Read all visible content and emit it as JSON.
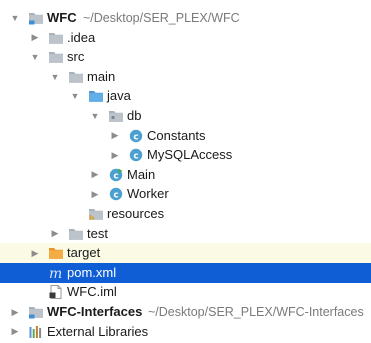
{
  "tree": [
    {
      "id": "wfc",
      "label": "WFC",
      "bold": true,
      "path": "~/Desktop/SER_PLEX/WFC",
      "icon": "module-folder-icon",
      "arrow": "expanded",
      "depth": 0
    },
    {
      "id": "idea",
      "label": ".idea",
      "icon": "folder-icon",
      "arrow": "collapsed",
      "depth": 1
    },
    {
      "id": "src",
      "label": "src",
      "icon": "folder-icon",
      "arrow": "expanded",
      "depth": 1
    },
    {
      "id": "main",
      "label": "main",
      "icon": "folder-icon",
      "arrow": "expanded",
      "depth": 2
    },
    {
      "id": "java",
      "label": "java",
      "icon": "source-folder-icon",
      "arrow": "expanded",
      "depth": 3
    },
    {
      "id": "db",
      "label": "db",
      "icon": "package-icon",
      "arrow": "expanded",
      "depth": 4
    },
    {
      "id": "constants",
      "label": "Constants",
      "icon": "class-icon",
      "arrow": "collapsed",
      "depth": 5
    },
    {
      "id": "mysqlaccess",
      "label": "MySQLAccess",
      "icon": "class-icon",
      "arrow": "collapsed",
      "depth": 5
    },
    {
      "id": "main-class",
      "label": "Main",
      "icon": "runnable-class-icon",
      "arrow": "collapsed",
      "depth": 4
    },
    {
      "id": "worker",
      "label": "Worker",
      "icon": "class-icon",
      "arrow": "collapsed",
      "depth": 4
    },
    {
      "id": "resources",
      "label": "resources",
      "icon": "resources-folder-icon",
      "arrow": "none",
      "depth": 3
    },
    {
      "id": "test",
      "label": "test",
      "icon": "folder-icon",
      "arrow": "collapsed",
      "depth": 2
    },
    {
      "id": "target",
      "label": "target",
      "icon": "excluded-folder-icon",
      "arrow": "collapsed",
      "depth": 1,
      "highlight": true
    },
    {
      "id": "pom",
      "label": "pom.xml",
      "icon": "maven-file-icon",
      "arrow": "none",
      "depth": 1,
      "selected": true
    },
    {
      "id": "wfc-iml",
      "label": "WFC.iml",
      "icon": "iml-file-icon",
      "arrow": "none",
      "depth": 1
    },
    {
      "id": "wfc-interfaces",
      "label": "WFC-Interfaces",
      "bold": true,
      "path": "~/Desktop/SER_PLEX/WFC-Interfaces",
      "icon": "module-folder-icon",
      "arrow": "collapsed",
      "depth": 0
    },
    {
      "id": "external-libraries",
      "label": "External Libraries",
      "icon": "libraries-icon",
      "arrow": "collapsed",
      "depth": 0
    }
  ],
  "colors": {
    "selection": "#0f5ed6",
    "target_highlight": "#fbfbe5",
    "folder": "#a9b1bb",
    "source_folder": "#58a7e3",
    "excluded_folder": "#f0a33a",
    "class_badge": "#4aa0d0",
    "path_text": "#7a7a7a"
  }
}
